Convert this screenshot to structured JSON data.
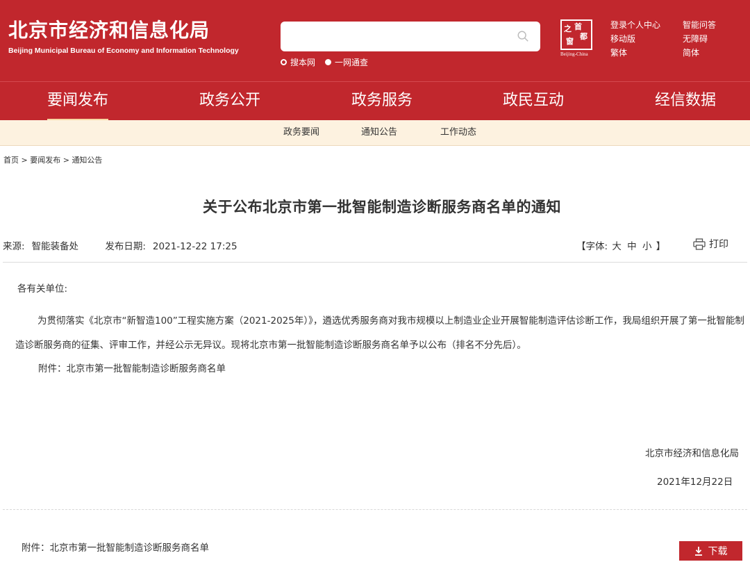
{
  "header": {
    "title": "北京市经济和信息化局",
    "subtitle": "Beijing Municipal Bureau of Economy and Information Technology",
    "search": {
      "placeholder": "",
      "options": [
        {
          "label": "搜本网",
          "selected": false
        },
        {
          "label": "一网通查",
          "selected": true
        }
      ]
    },
    "logo": {
      "chars": [
        "之",
        "首",
        "都",
        "窗"
      ],
      "caption": "Beijing-China"
    },
    "links": [
      "登录个人中心",
      "智能问答",
      "移动版",
      "无障碍",
      "繁体",
      "简体"
    ]
  },
  "mainnav": {
    "items": [
      "要闻发布",
      "政务公开",
      "政务服务",
      "政民互动",
      "经信数据"
    ],
    "active_index": 0
  },
  "subnav": {
    "items": [
      "政务要闻",
      "通知公告",
      "工作动态"
    ]
  },
  "breadcrumb": {
    "items": [
      "首页",
      "要闻发布",
      "通知公告"
    ],
    "separator": ">"
  },
  "article": {
    "title": "关于公布北京市第一批智能制造诊断服务商名单的通知",
    "source_label": "来源:",
    "source": "智能装备处",
    "date_label": "发布日期:",
    "date": "2021-12-22 17:25",
    "font_label": "【字体:",
    "font_sizes": [
      "大",
      "中",
      "小"
    ],
    "font_close": "】",
    "print_label": "打印",
    "salutation": "各有关单位:",
    "paragraph": "为贯彻落实《北京市“新智造100”工程实施方案（2021-2025年）》，遴选优秀服务商对我市规模以上制造业企业开展智能制造评估诊断工作，我局组织开展了第一批智能制造诊断服务商的征集、评审工作，并经公示无异议。现将北京市第一批智能制造诊断服务商名单予以公布（排名不分先后）。",
    "attachment_line": "附件：北京市第一批智能制造诊断服务商名单",
    "signature": "北京市经济和信息化局",
    "sign_date": "2021年12月22日"
  },
  "attachment": {
    "label": "附件：北京市第一批智能制造诊断服务商名单",
    "download_label": "下载"
  },
  "colors": {
    "brand_red": "#c1272d",
    "subnav_bg": "#fdf2e0",
    "active_underline": "#f7d9a5"
  }
}
